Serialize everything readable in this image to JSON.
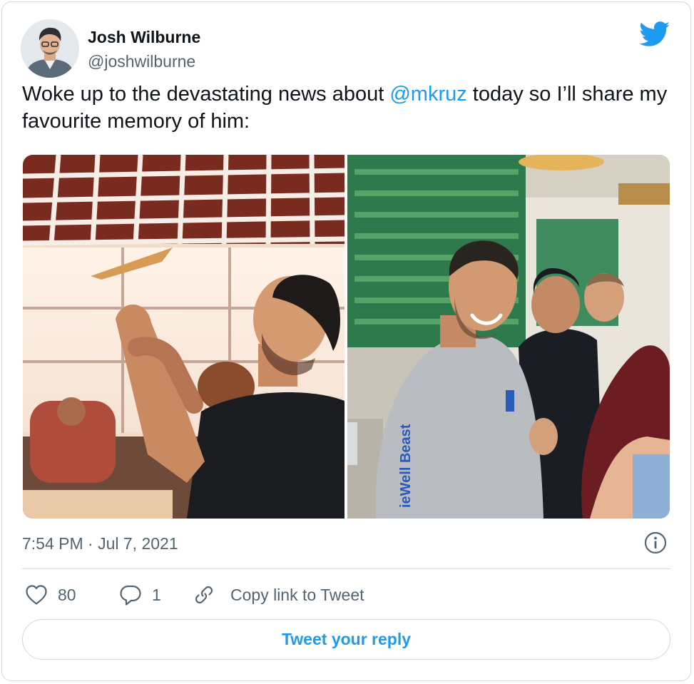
{
  "author": {
    "name": "Josh Wilburne",
    "handle": "@joshwilburne"
  },
  "tweet": {
    "text_before": "Woke up to the devastating news about ",
    "mention": "@mkruz",
    "text_after": " today so I’ll share my favourite memory of him:",
    "sleeve_text": "ieWell Beast"
  },
  "meta": {
    "timestamp": "7:54 PM · Jul 7, 2021"
  },
  "actions": {
    "likes": "80",
    "replies": "1",
    "copy_link": "Copy link to Tweet",
    "reply_button": "Tweet your reply"
  },
  "icons": {
    "brand": "twitter-bird-icon",
    "info": "info-icon",
    "like": "heart-icon",
    "reply": "speech-bubble-icon",
    "copy": "link-icon"
  },
  "colors": {
    "accent": "#1d9bf0",
    "text_primary": "#0f1419",
    "text_secondary": "#536471",
    "border": "#cfd9de"
  }
}
